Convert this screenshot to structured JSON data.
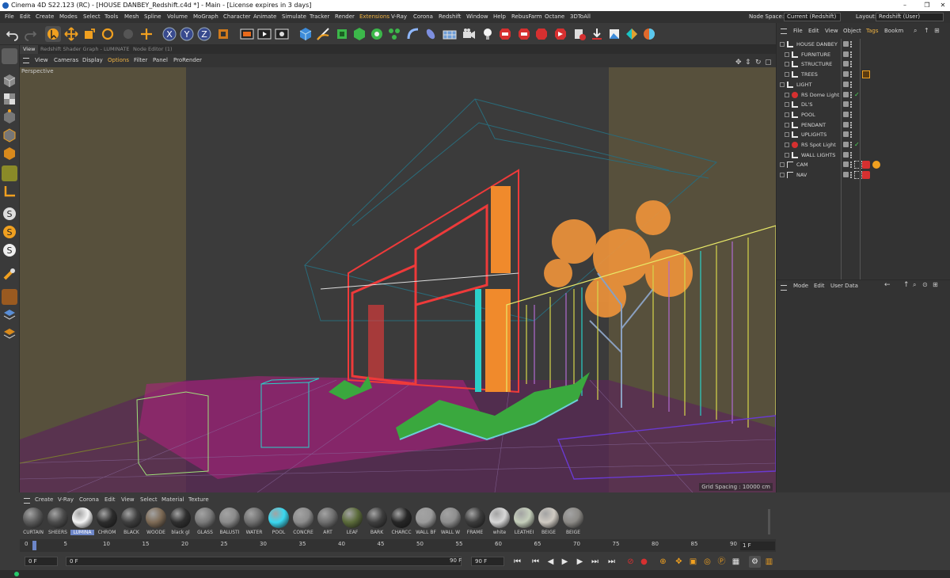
{
  "window": {
    "title": "Cinema 4D S22.123 (RC) - [HOUSE DANBEY_Redshift.c4d *] - Main - [License expires in 3 days]",
    "controls": [
      "–",
      "❐",
      "✕"
    ]
  },
  "menubar": {
    "items": [
      "File",
      "Edit",
      "Create",
      "Modes",
      "Select",
      "Tools",
      "Mesh",
      "Spline",
      "Volume",
      "MoGraph",
      "Character",
      "Animate",
      "Simulate",
      "Tracker",
      "Render",
      "Extensions",
      "V-Ray",
      "Corona",
      "Redshift",
      "Window",
      "Help",
      "RebusFarm",
      "Octane",
      "3DToAll"
    ],
    "highlighted": "Extensions",
    "node_space_label": "Node Space:",
    "node_space_value": "Current (Redshift)",
    "layout_label": "Layout:",
    "layout_value": "Redshift (User)"
  },
  "viewport": {
    "tabs": [
      "View",
      "Redshift Shader Graph - LUMINATE",
      "Node Editor (1)"
    ],
    "active_tab": "View",
    "menu": [
      "View",
      "Cameras",
      "Display",
      "Options",
      "Filter",
      "Panel",
      "ProRender"
    ],
    "highlighted_menu": "Options",
    "camera_label": "Perspective",
    "grid_spacing": "Grid Spacing : 10000 cm"
  },
  "object_manager": {
    "menu": [
      "File",
      "Edit",
      "View",
      "Object",
      "Tags",
      "Bookm"
    ],
    "highlighted_menu": "Tags",
    "objects": [
      {
        "name": "HOUSE DANBEY",
        "indent": 0,
        "type": "layer",
        "tick": false,
        "tag": ""
      },
      {
        "name": "FURNITURE",
        "indent": 1,
        "type": "layer",
        "tick": false,
        "tag": ""
      },
      {
        "name": "STRUCTURE",
        "indent": 1,
        "type": "layer",
        "tick": false,
        "tag": ""
      },
      {
        "name": "TREES",
        "indent": 1,
        "type": "layer",
        "tick": false,
        "tag": "orange"
      },
      {
        "name": "LIGHT",
        "indent": 0,
        "type": "layer",
        "tick": false,
        "tag": ""
      },
      {
        "name": "RS Dome Light",
        "indent": 1,
        "type": "light",
        "tick": true,
        "tag": ""
      },
      {
        "name": "DL'S",
        "indent": 1,
        "type": "layer",
        "tick": false,
        "tag": ""
      },
      {
        "name": "POOL",
        "indent": 1,
        "type": "layer",
        "tick": false,
        "tag": ""
      },
      {
        "name": "PENDANT",
        "indent": 1,
        "type": "layer",
        "tick": false,
        "tag": ""
      },
      {
        "name": "UPLIGHTS",
        "indent": 1,
        "type": "layer",
        "tick": false,
        "tag": ""
      },
      {
        "name": "RS Spot Light",
        "indent": 1,
        "type": "light",
        "tick": true,
        "tag": ""
      },
      {
        "name": "WALL LIGHTS",
        "indent": 1,
        "type": "layer",
        "tick": false,
        "tag": ""
      },
      {
        "name": "CAM",
        "indent": 0,
        "type": "camera",
        "tick": false,
        "tag": "red2"
      },
      {
        "name": "NAV",
        "indent": 0,
        "type": "camera",
        "tick": false,
        "tag": "red"
      }
    ]
  },
  "attribute_manager": {
    "menu": [
      "Mode",
      "Edit",
      "User Data"
    ]
  },
  "material_manager": {
    "menu": [
      "Create",
      "V-Ray",
      "Corona",
      "Edit",
      "View",
      "Select",
      "Material",
      "Texture"
    ],
    "selected": "LUMINA",
    "materials": [
      {
        "name": "CURTAIN",
        "color": "#5a5a5a"
      },
      {
        "name": "SHEERS",
        "color": "#4c4c4c"
      },
      {
        "name": "LUMINA",
        "color": "#f4f4f4"
      },
      {
        "name": "CHROM",
        "color": "#2c2c2c"
      },
      {
        "name": "BLACK",
        "color": "#3e3e3e"
      },
      {
        "name": "WOODE",
        "color": "#7d6a55"
      },
      {
        "name": "black gl",
        "color": "#2e2e2e"
      },
      {
        "name": "GLASS",
        "color": "#7a7a7a"
      },
      {
        "name": "BALUSTI",
        "color": "#8a8a8a"
      },
      {
        "name": "WATER",
        "color": "#6f6f6f"
      },
      {
        "name": "POOL",
        "color": "#3ad8f0"
      },
      {
        "name": "CONCRE",
        "color": "#8c8c8c"
      },
      {
        "name": "ART",
        "color": "#6e6e6e"
      },
      {
        "name": "LEAF",
        "color": "#5b6b3a"
      },
      {
        "name": "BARK",
        "color": "#3e3e3e"
      },
      {
        "name": "CHARCC",
        "color": "#262626"
      },
      {
        "name": "WALL BF",
        "color": "#9b9b9b"
      },
      {
        "name": "WALL W",
        "color": "#8e8e8e"
      },
      {
        "name": "FRAME",
        "color": "#3b3b3b"
      },
      {
        "name": "white",
        "color": "#d8d8d8"
      },
      {
        "name": "LEATHEI",
        "color": "#c5cfbb"
      },
      {
        "name": "BEIGE",
        "color": "#cfcac2"
      },
      {
        "name": "BEIGE",
        "color": "#8c8a86"
      }
    ]
  },
  "timeline": {
    "ticks": [
      "0",
      "5",
      "10",
      "15",
      "20",
      "25",
      "30",
      "35",
      "40",
      "45",
      "50",
      "55",
      "60",
      "65",
      "70",
      "75",
      "80",
      "85",
      "90"
    ],
    "current_frame": "1 F"
  },
  "transport": {
    "start": "0 F",
    "current": "0 F",
    "end_a": "90 F",
    "end_b": "90 F"
  },
  "colors": {
    "accent": "#f0b343",
    "selection": "#6d86c8",
    "bg": "#3a3a3a"
  }
}
